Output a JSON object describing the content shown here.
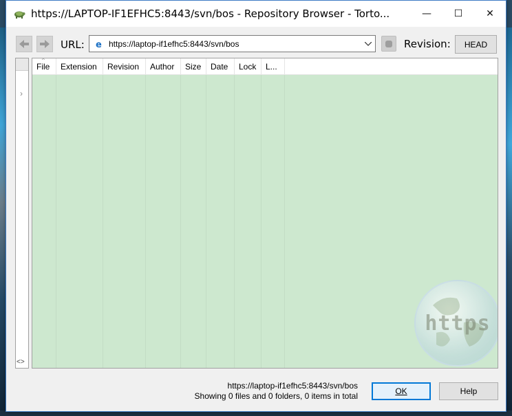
{
  "window": {
    "title": "https://LAPTOP-IF1EFHC5:8443/svn/bos - Repository Browser - Torto...",
    "minimize_glyph": "—",
    "maximize_glyph": "☐",
    "close_glyph": "✕"
  },
  "toolbar": {
    "url_label": "URL:",
    "url_value": "https://laptop-if1efhc5:8443/svn/bos",
    "revision_label": "Revision:",
    "head_button": "HEAD"
  },
  "columns": [
    "File",
    "Extension",
    "Revision",
    "Author",
    "Size",
    "Date",
    "Lock",
    "L..."
  ],
  "watermark_text": "https",
  "status": {
    "url": "https://laptop-if1efhc5:8443/svn/bos",
    "summary": "Showing 0 files and 0 folders, 0 items in total"
  },
  "buttons": {
    "ok": "OK",
    "help": "Help"
  },
  "tree": {
    "scroll_glyph": "<>"
  },
  "colors": {
    "list_background": "#cde8cf",
    "accent": "#0078d7"
  }
}
